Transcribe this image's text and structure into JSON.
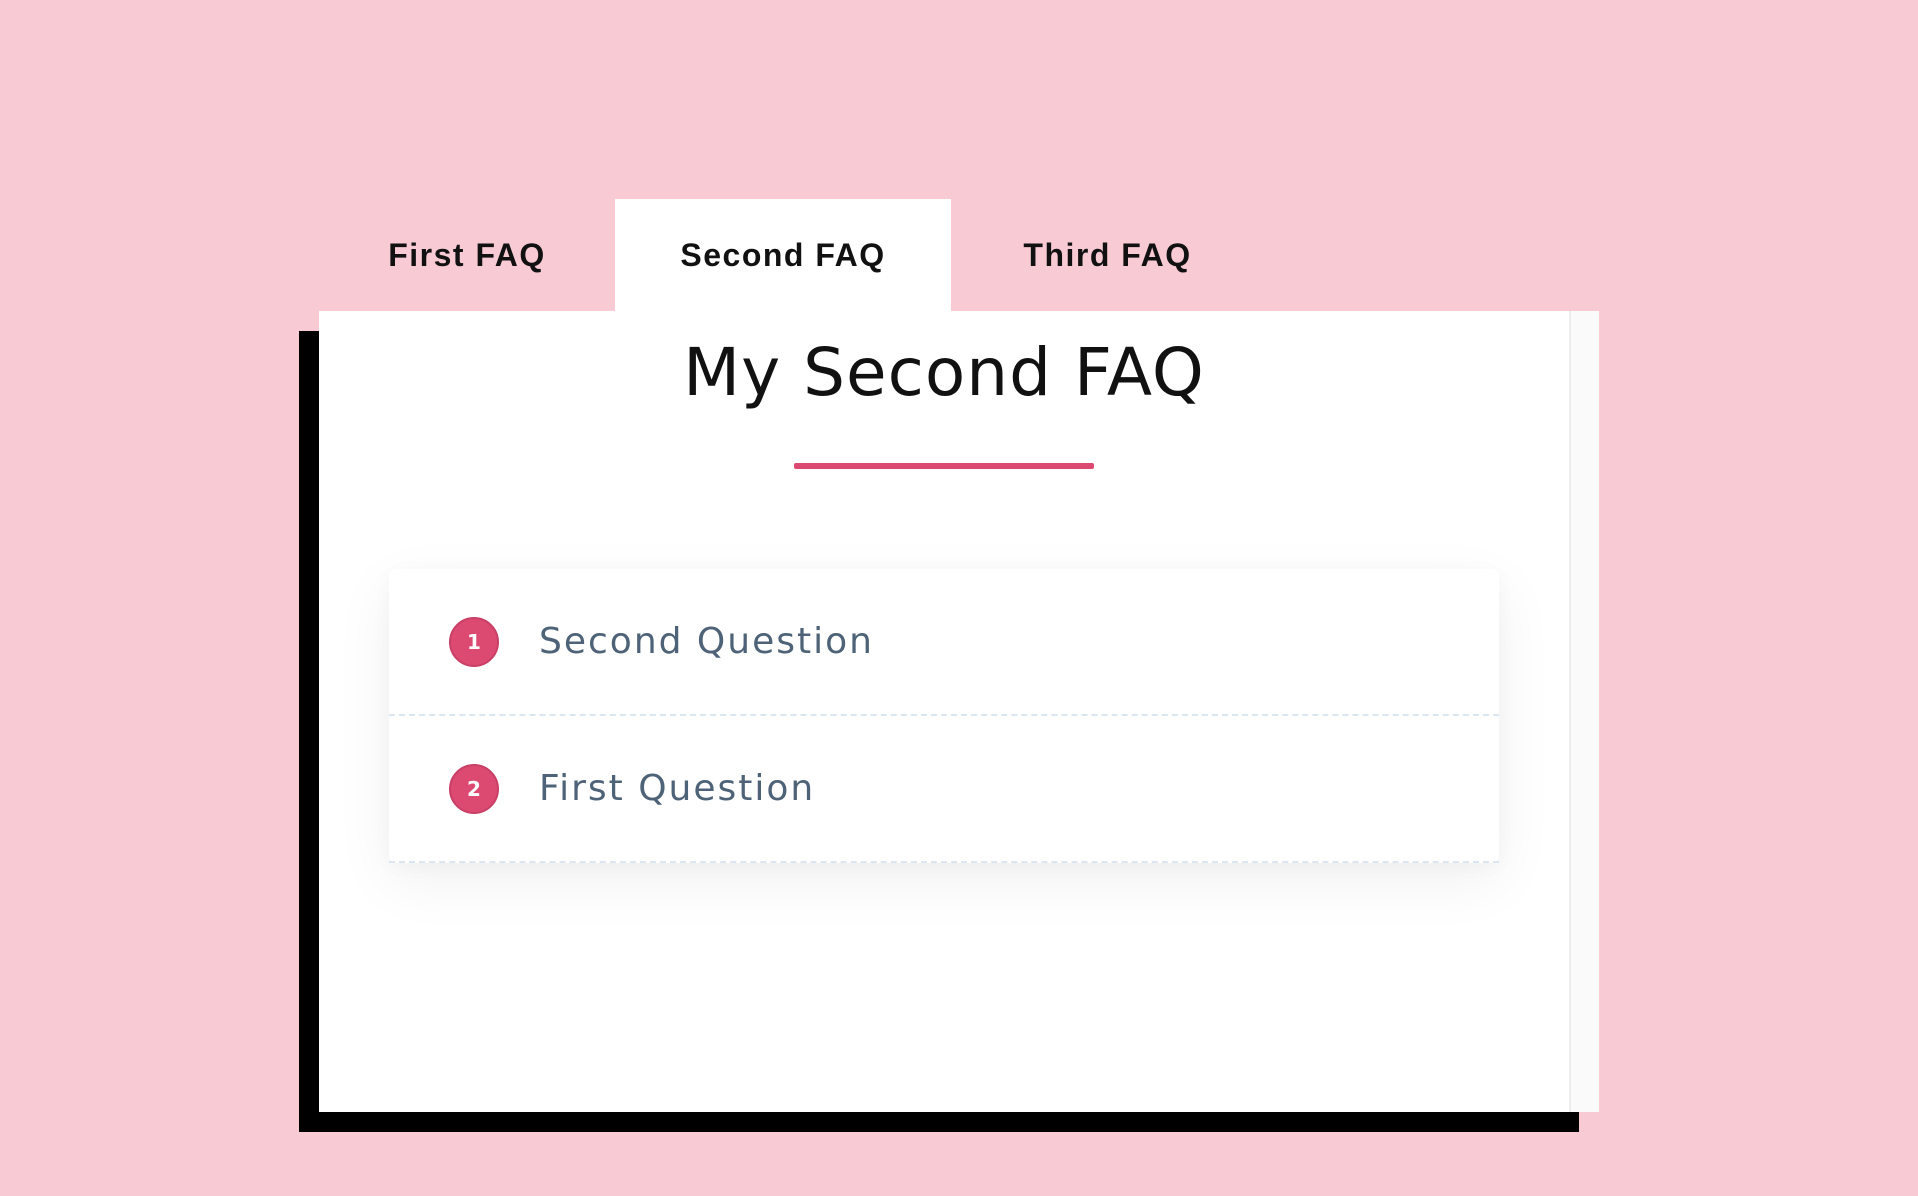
{
  "tabs": [
    {
      "label": "First FAQ",
      "active": false
    },
    {
      "label": "Second FAQ",
      "active": true
    },
    {
      "label": "Third FAQ",
      "active": false
    }
  ],
  "panel": {
    "title": "My Second FAQ",
    "accent_color": "#dc4a72",
    "questions": [
      {
        "number": "1",
        "text": "Second Question"
      },
      {
        "number": "2",
        "text": "First Question"
      }
    ]
  },
  "colors": {
    "background": "#f8cad3",
    "accent": "#dc4a72",
    "question_text": "#4f6378"
  }
}
